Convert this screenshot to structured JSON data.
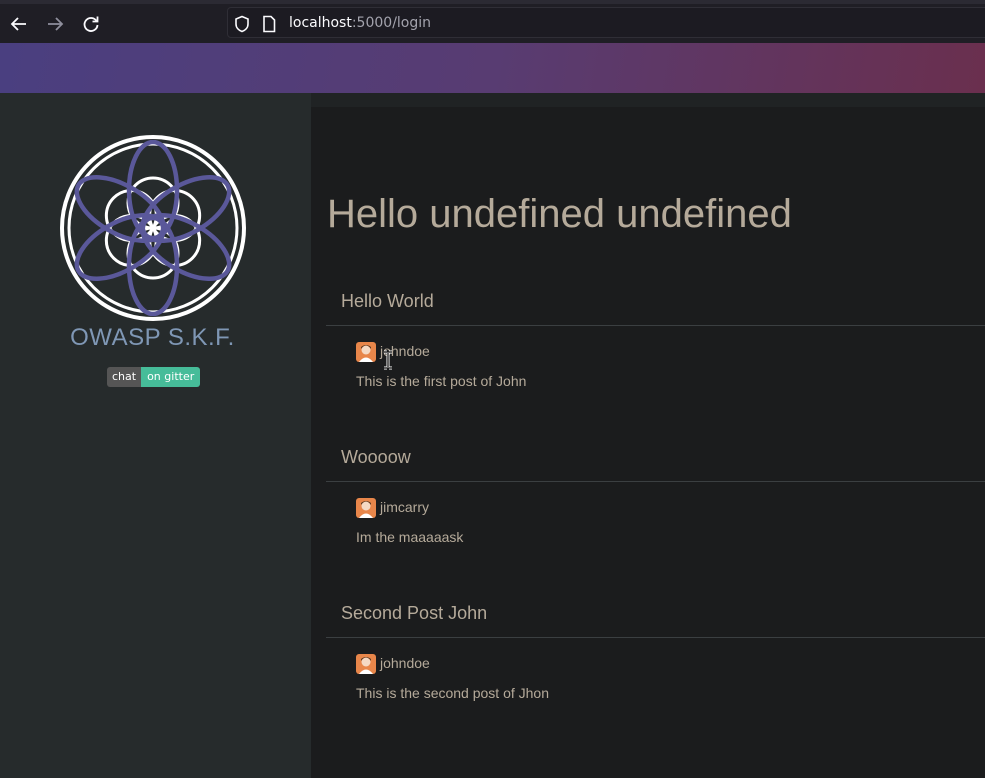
{
  "browser": {
    "url_host": "localhost",
    "url_rest": ":5000/login"
  },
  "sidebar": {
    "brand": "OWASP S.K.F.",
    "badge_left": "chat",
    "badge_right": "on gitter"
  },
  "main": {
    "greeting": "Hello undefined undefined",
    "posts": [
      {
        "title": "Hello World",
        "author": "johndoe",
        "body": "This is the first post of John"
      },
      {
        "title": "Woooow",
        "author": "jimcarry",
        "body": "Im the maaaaask"
      },
      {
        "title": "Second Post John",
        "author": "johndoe",
        "body": "This is the second post of Jhon"
      }
    ]
  },
  "icons": {
    "back": "arrow-left-icon",
    "forward": "arrow-right-icon",
    "reload": "reload-icon",
    "shield": "shield-icon",
    "page": "page-icon",
    "avatar": "avatar-icon",
    "cursor": "text-cursor-icon"
  },
  "colors": {
    "banner_start": "#4a3f80",
    "banner_end": "#6a2f4e",
    "brand_text": "#7f97b5",
    "content_text": "#b5aa9a",
    "gitter_green": "#46bc99"
  }
}
